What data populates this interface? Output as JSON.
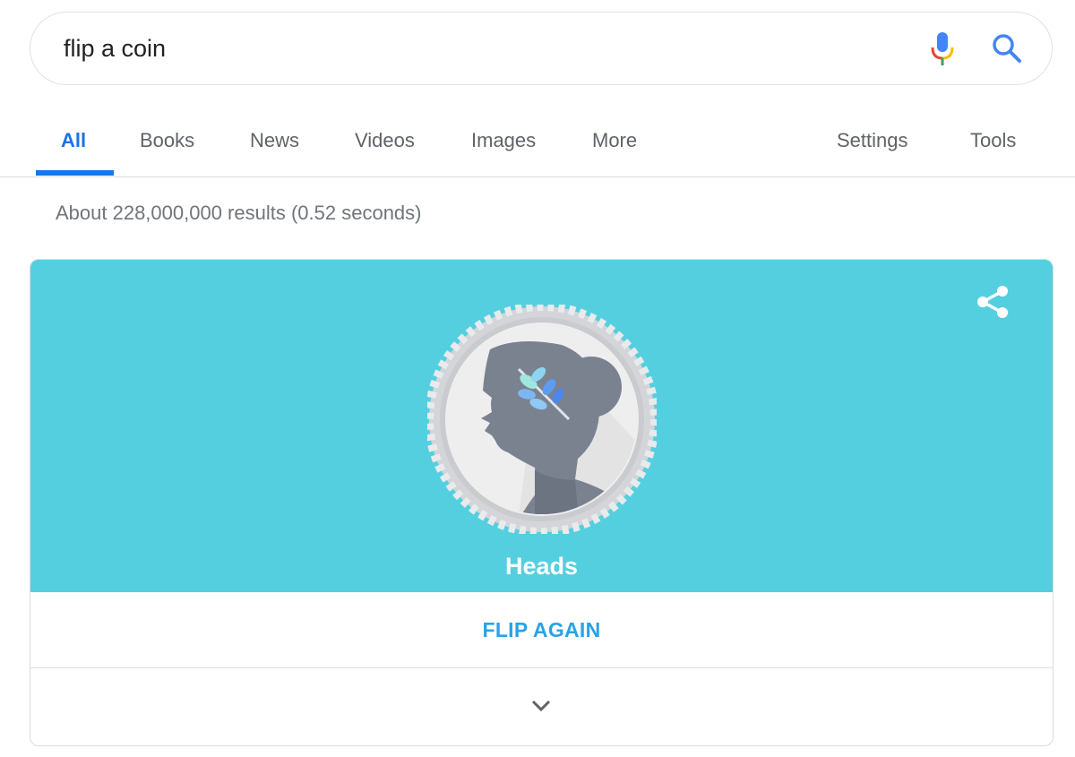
{
  "search": {
    "query": "flip a coin",
    "icons": [
      "mic-icon",
      "search-icon"
    ]
  },
  "tabs": {
    "items": [
      {
        "label": "All",
        "active": true
      },
      {
        "label": "Books"
      },
      {
        "label": "News"
      },
      {
        "label": "Videos"
      },
      {
        "label": "Images"
      },
      {
        "label": "More"
      }
    ],
    "right": [
      {
        "label": "Settings"
      },
      {
        "label": "Tools"
      }
    ]
  },
  "result_stats": "About 228,000,000 results (0.52 seconds)",
  "coin_card": {
    "result": "Heads",
    "flip_label": "FLIP AGAIN",
    "icons": [
      "share-icon",
      "coin-heads-icon",
      "chevron-down-icon"
    ],
    "colors": {
      "panel": "#54cfdf",
      "button_text": "#29a3e4",
      "accent": "#1a73e8"
    }
  }
}
